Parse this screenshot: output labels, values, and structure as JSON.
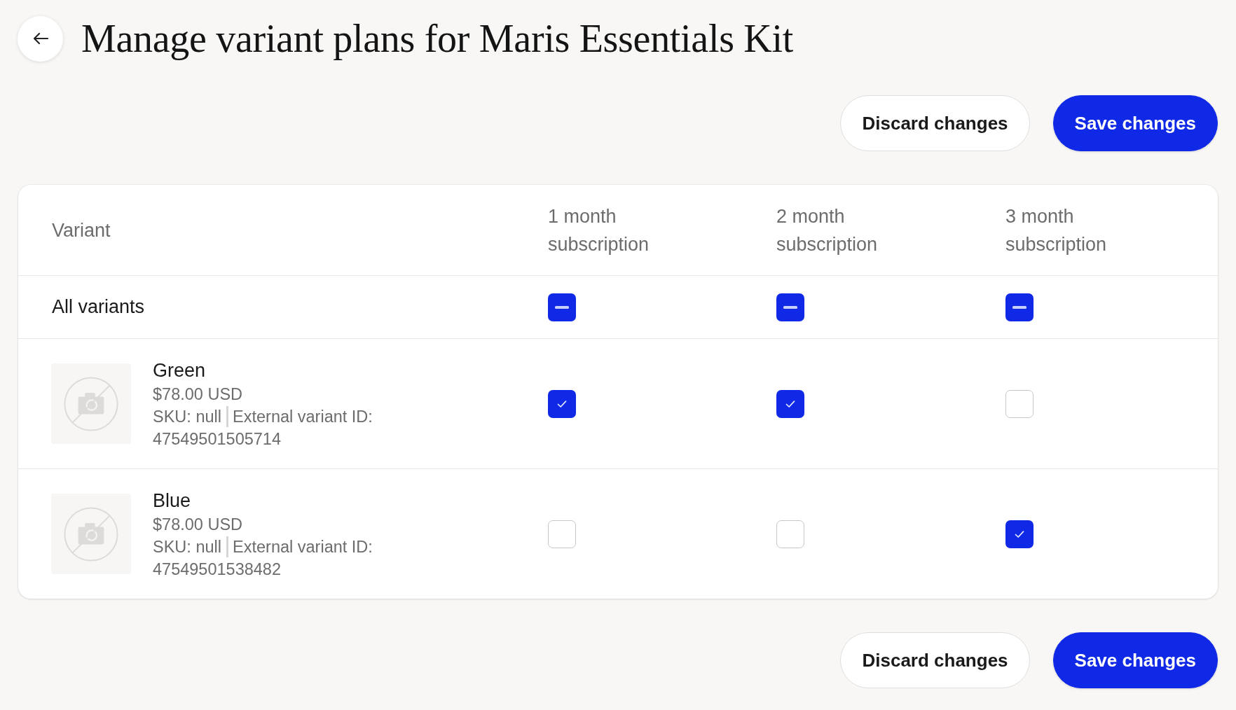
{
  "page": {
    "title": "Manage variant plans for Maris Essentials Kit"
  },
  "top_actions": [
    {
      "label": "Discard changes",
      "kind": "secondary"
    },
    {
      "label": "Save changes",
      "kind": "primary"
    }
  ],
  "table": {
    "columns": [
      "Variant",
      "1 month subscription",
      "2 month subscription",
      "3 month subscription"
    ],
    "all_variants": {
      "label": "All variants",
      "plans": [
        {
          "indeterminate": true
        },
        {
          "indeterminate": true
        },
        {
          "indeterminate": true
        }
      ]
    },
    "variants": [
      {
        "name": "Green",
        "price": "$78.00 USD",
        "sku": "SKU: null",
        "external_id": "External variant ID: 47549501505714",
        "plans": [
          {
            "checked": true
          },
          {
            "checked": true
          },
          {
            "checked": false
          }
        ]
      },
      {
        "name": "Blue",
        "price": "$78.00 USD",
        "sku": "SKU: null",
        "external_id": "External variant ID: 47549501538482",
        "plans": [
          {
            "checked": false
          },
          {
            "checked": false
          },
          {
            "checked": true
          }
        ]
      }
    ]
  },
  "bottom_actions": [
    {
      "label": "Discard changes",
      "kind": "secondary"
    },
    {
      "label": "Save changes",
      "kind": "primary"
    }
  ]
}
